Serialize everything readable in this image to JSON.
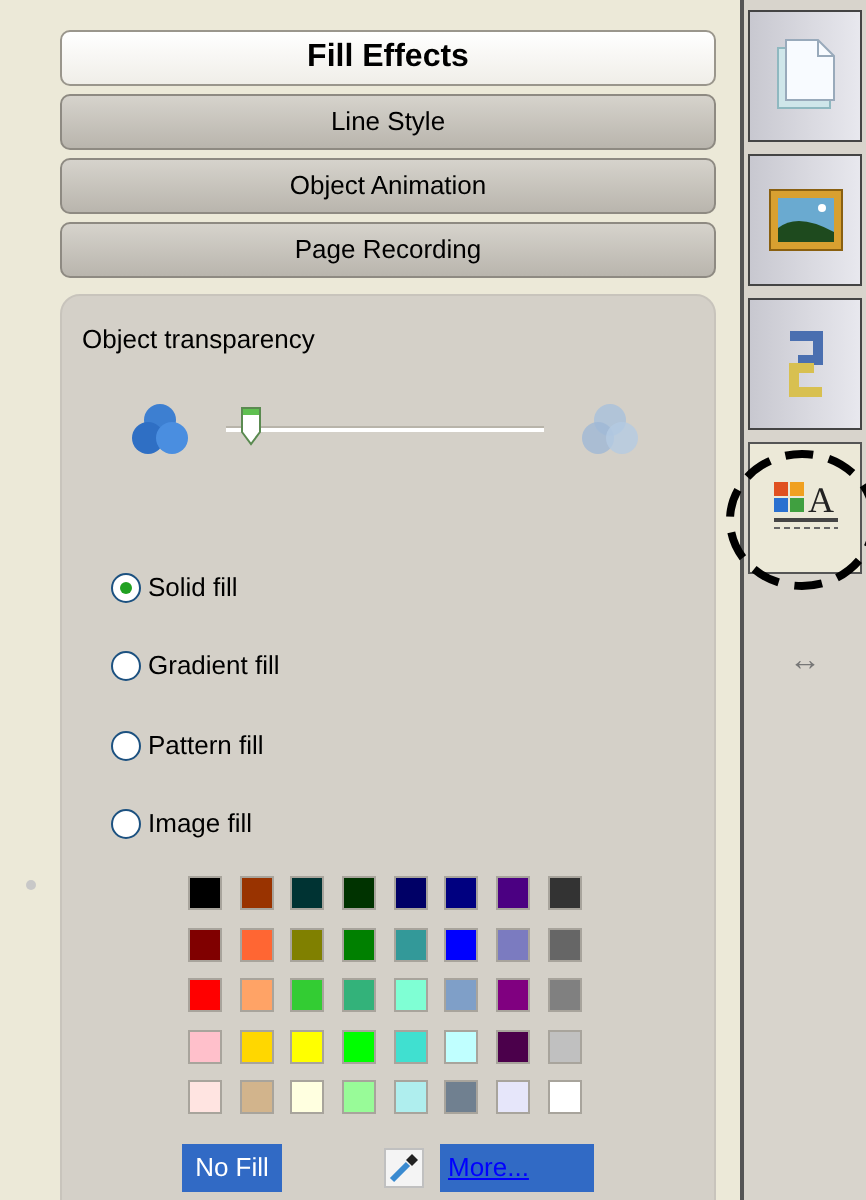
{
  "tabs": [
    {
      "label": "Fill Effects",
      "selected": true
    },
    {
      "label": "Line Style",
      "selected": false
    },
    {
      "label": "Object Animation",
      "selected": false
    },
    {
      "label": "Page Recording",
      "selected": false
    }
  ],
  "transparency": {
    "label": "Object transparency",
    "level": 0.05
  },
  "fill_options": [
    {
      "label": "Solid fill",
      "selected": true
    },
    {
      "label": "Gradient fill",
      "selected": false
    },
    {
      "label": "Pattern fill",
      "selected": false
    },
    {
      "label": "Image fill",
      "selected": false
    }
  ],
  "palette": [
    [
      {
        "color": "#000000"
      },
      {
        "color": "#993300"
      },
      {
        "color": "#003333"
      },
      {
        "color": "#003300"
      },
      {
        "color": "#000066"
      },
      {
        "color": "#000080"
      },
      {
        "color": "#4b0082"
      },
      {
        "color": "#333333"
      }
    ],
    [
      {
        "color": "#800000"
      },
      {
        "color": "#ff6633"
      },
      {
        "color": "#808000"
      },
      {
        "color": "#008000"
      },
      {
        "color": "#339999"
      },
      {
        "color": "#0000ff"
      },
      {
        "color": "#7b7bc0"
      },
      {
        "color": "#666666"
      }
    ],
    [
      {
        "color": "#ff0000"
      },
      {
        "color": "#ffa366"
      },
      {
        "color": "#33cc33"
      },
      {
        "color": "#33b27a"
      },
      {
        "color": "#7fffd4"
      },
      {
        "color": "#7f9fc8"
      },
      {
        "color": "#800080"
      },
      {
        "color": "#808080"
      }
    ],
    [
      {
        "color": "#ffc0cb"
      },
      {
        "color": "#ffd700"
      },
      {
        "color": "#ffff00"
      },
      {
        "color": "#00ff00"
      },
      {
        "color": "#40e0d0"
      },
      {
        "color": "#c0ffff"
      },
      {
        "color": "#4b004b"
      },
      {
        "color": "#c0c0c0"
      }
    ],
    [
      {
        "color": "#ffe4e1"
      },
      {
        "color": "#d2b48c"
      },
      {
        "color": "#ffffe0"
      },
      {
        "color": "#98fb98"
      },
      {
        "color": "#afeeee"
      },
      {
        "color": "#708090"
      },
      {
        "color": "#e6e6fa"
      },
      {
        "color": "#ffffff"
      }
    ]
  ],
  "no_fill": "No Fill",
  "more": "More...",
  "sidebar": {
    "items": [
      {
        "kind": "page",
        "selected": false
      },
      {
        "kind": "picture",
        "selected": false
      },
      {
        "kind": "link",
        "selected": false
      },
      {
        "kind": "fill",
        "selected": true,
        "glyph": "A"
      }
    ],
    "resize": "↔"
  }
}
